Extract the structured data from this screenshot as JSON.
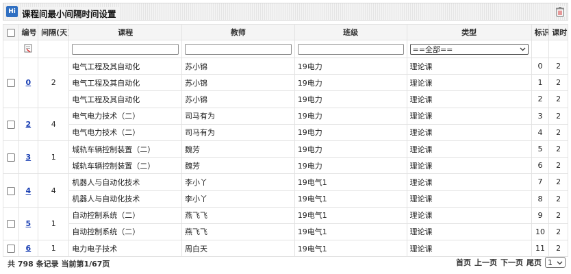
{
  "header": {
    "logo_text": "Hi",
    "title": "课程间最小间隔时间设置",
    "delete_icon": "trash-icon"
  },
  "columns": {
    "id": "编号",
    "interval": "间隔(天)",
    "course": "课程",
    "teacher": "教师",
    "class": "班级",
    "type": "类型",
    "mark": "标识",
    "hours": "课时"
  },
  "filters": {
    "course": "",
    "teacher": "",
    "class": "",
    "type_selected": "==全部=="
  },
  "groups": [
    {
      "id": "0",
      "interval": "2",
      "rows": [
        {
          "course": "电气工程及其自动化",
          "teacher": "苏小锦",
          "class": "19电力",
          "type": "理论课",
          "mark": "0",
          "hours": "2"
        },
        {
          "course": "电气工程及其自动化",
          "teacher": "苏小锦",
          "class": "19电力",
          "type": "理论课",
          "mark": "1",
          "hours": "2"
        },
        {
          "course": "电气工程及其自动化",
          "teacher": "苏小锦",
          "class": "19电力",
          "type": "理论课",
          "mark": "2",
          "hours": "2"
        }
      ]
    },
    {
      "id": "2",
      "interval": "4",
      "rows": [
        {
          "course": "电气电力技术（二）",
          "teacher": "司马有为",
          "class": "19电力",
          "type": "理论课",
          "mark": "3",
          "hours": "2"
        },
        {
          "course": "电气电力技术（二）",
          "teacher": "司马有为",
          "class": "19电力",
          "type": "理论课",
          "mark": "4",
          "hours": "2"
        }
      ]
    },
    {
      "id": "3",
      "interval": "1",
      "rows": [
        {
          "course": "城轨车辆控制装置（二）",
          "teacher": "魏芳",
          "class": "19电力",
          "type": "理论课",
          "mark": "5",
          "hours": "2"
        },
        {
          "course": "城轨车辆控制装置（二）",
          "teacher": "魏芳",
          "class": "19电力",
          "type": "理论课",
          "mark": "6",
          "hours": "2"
        }
      ]
    },
    {
      "id": "4",
      "interval": "4",
      "rows": [
        {
          "course": "机器人与自动化技术",
          "teacher": "李小丫",
          "class": "19电气1",
          "type": "理论课",
          "mark": "7",
          "hours": "2"
        },
        {
          "course": "机器人与自动化技术",
          "teacher": "李小丫",
          "class": "19电气1",
          "type": "理论课",
          "mark": "8",
          "hours": "2"
        }
      ]
    },
    {
      "id": "5",
      "interval": "1",
      "rows": [
        {
          "course": "自动控制系统（二）",
          "teacher": "燕飞飞",
          "class": "19电气1",
          "type": "理论课",
          "mark": "9",
          "hours": "2"
        },
        {
          "course": "自动控制系统（二）",
          "teacher": "燕飞飞",
          "class": "19电气1",
          "type": "理论课",
          "mark": "10",
          "hours": "2"
        }
      ]
    },
    {
      "id": "6",
      "interval": "1",
      "rows": [
        {
          "course": "电力电子技术",
          "teacher": "周白天",
          "class": "19电气1",
          "type": "理论课",
          "mark": "11",
          "hours": "2"
        }
      ]
    }
  ],
  "footer": {
    "summary": "共 798 条记录 当前第1/67页",
    "first": "首页",
    "prev": "上一页",
    "next": "下一页",
    "last": "尾页",
    "page_selected": "1"
  }
}
